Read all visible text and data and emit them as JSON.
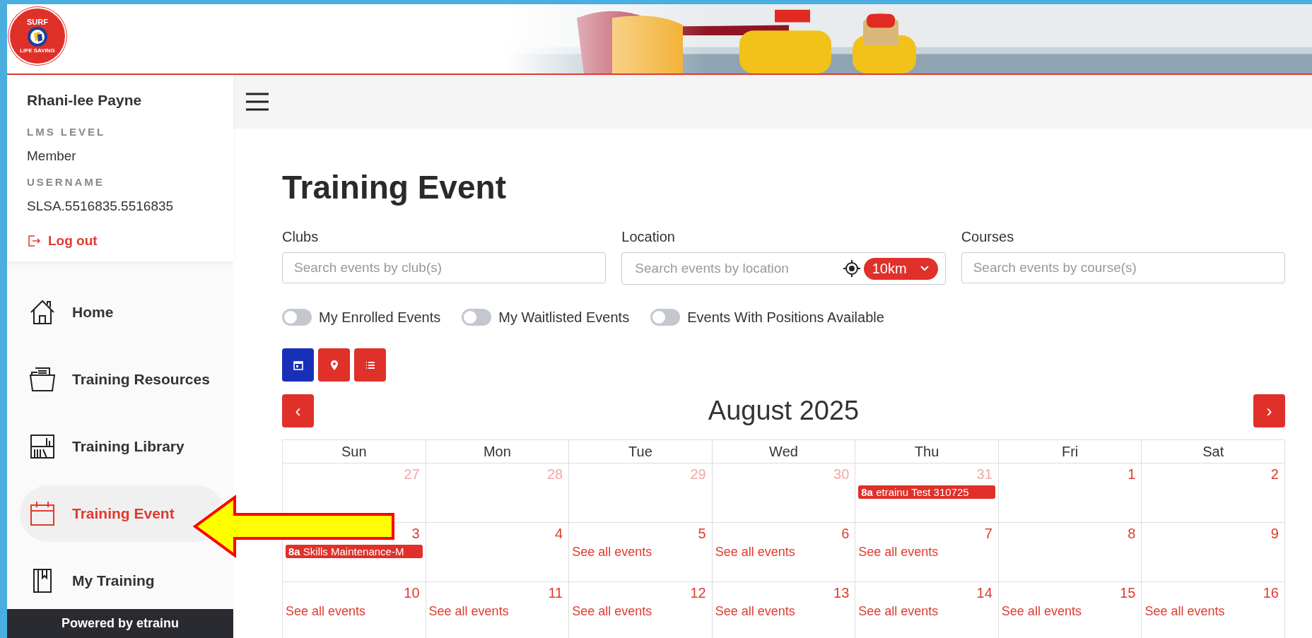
{
  "logo": {
    "top_text": "SURF",
    "bottom_text": "LIFE SAVING"
  },
  "user": {
    "name": "Rhani-lee Payne",
    "fields": [
      {
        "label": "LMS LEVEL",
        "value": "Member"
      },
      {
        "label": "USERNAME",
        "value": "SLSA.5516835.5516835"
      }
    ],
    "logout": "Log out"
  },
  "nav": [
    {
      "label": "Home",
      "selected": false
    },
    {
      "label": "Training Resources",
      "selected": false
    },
    {
      "label": "Training Library",
      "selected": false
    },
    {
      "label": "Training Event",
      "selected": true
    },
    {
      "label": "My Training",
      "selected": false
    }
  ],
  "footer": "Powered by etrainu",
  "page_title": "Training Event",
  "filters": [
    {
      "label": "Clubs",
      "placeholder": "Search events by club(s)"
    },
    {
      "label": "Location",
      "placeholder": "Search events by location",
      "radius": "10km"
    },
    {
      "label": "Courses",
      "placeholder": "Search events by course(s)"
    }
  ],
  "toggles": [
    {
      "label": "My Enrolled Events",
      "on": false
    },
    {
      "label": "My Waitlisted Events",
      "on": false
    },
    {
      "label": "Events With Positions Available",
      "on": false
    }
  ],
  "views": [
    {
      "selected": true
    },
    {
      "selected": false
    },
    {
      "selected": false
    }
  ],
  "calendar": {
    "month": "August 2025",
    "prev": "‹",
    "next": "›",
    "weekdays": [
      "Sun",
      "Mon",
      "Tue",
      "Wed",
      "Thu",
      "Fri",
      "Sat"
    ],
    "weeks": [
      [
        {
          "day": "27",
          "muted": true
        },
        {
          "day": "28",
          "muted": true
        },
        {
          "day": "29",
          "muted": true
        },
        {
          "day": "30",
          "muted": true
        },
        {
          "day": "31",
          "muted": true,
          "events": [
            {
              "time": "8a",
              "title": "etrainu Test 310725"
            }
          ]
        },
        {
          "day": "1",
          "muted": false
        },
        {
          "day": "2",
          "muted": false
        }
      ],
      [
        {
          "day": "3",
          "muted": false,
          "events": [
            {
              "time": "8a",
              "title": "Skills Maintenance-M"
            }
          ]
        },
        {
          "day": "4",
          "muted": false
        },
        {
          "day": "5",
          "muted": false,
          "link": "See all events"
        },
        {
          "day": "6",
          "muted": false,
          "link": "See all events"
        },
        {
          "day": "7",
          "muted": false,
          "link": "See all events"
        },
        {
          "day": "8",
          "muted": false
        },
        {
          "day": "9",
          "muted": false
        }
      ],
      [
        {
          "day": "10",
          "muted": false,
          "link": "See all events"
        },
        {
          "day": "11",
          "muted": false,
          "link": "See all events"
        },
        {
          "day": "12",
          "muted": false,
          "link": "See all events"
        },
        {
          "day": "13",
          "muted": false,
          "link": "See all events"
        },
        {
          "day": "14",
          "muted": false,
          "link": "See all events"
        },
        {
          "day": "15",
          "muted": false,
          "link": "See all events"
        },
        {
          "day": "16",
          "muted": false,
          "link": "See all events"
        }
      ]
    ]
  }
}
